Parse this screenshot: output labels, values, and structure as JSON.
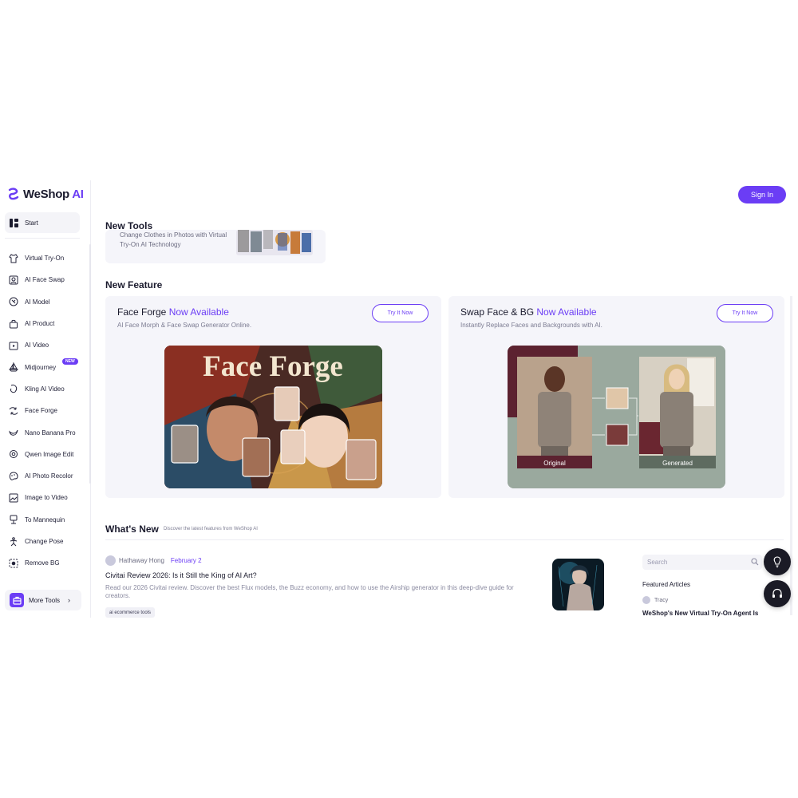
{
  "brand": {
    "name": "WeShop",
    "ai": "AI"
  },
  "header": {
    "sign_in": "Sign In"
  },
  "sidebar": {
    "start": "Start",
    "items": [
      {
        "label": "Virtual Try-On",
        "icon": "shirt-icon"
      },
      {
        "label": "AI Face Swap",
        "icon": "face-icon"
      },
      {
        "label": "AI Model",
        "icon": "model-icon"
      },
      {
        "label": "AI Product",
        "icon": "bag-icon"
      },
      {
        "label": "AI Video",
        "icon": "video-icon"
      },
      {
        "label": "Midjourney",
        "icon": "ship-icon",
        "badge": "NEW"
      },
      {
        "label": "Kling AI Video",
        "icon": "kling-icon"
      },
      {
        "label": "Face Forge",
        "icon": "swap-icon"
      },
      {
        "label": "Nano Banana Pro",
        "icon": "banana-icon"
      },
      {
        "label": "Qwen Image Edit",
        "icon": "qwen-icon"
      },
      {
        "label": "AI Photo Recolor",
        "icon": "palette-icon"
      },
      {
        "label": "Image to Video",
        "icon": "image-video-icon"
      },
      {
        "label": "To Mannequin",
        "icon": "mannequin-icon"
      },
      {
        "label": "Change Pose",
        "icon": "pose-icon"
      },
      {
        "label": "Remove BG",
        "icon": "remove-bg-icon"
      }
    ],
    "more_tools": "More Tools"
  },
  "new_tools": {
    "title": "New Tools",
    "description": "Change Clothes in Photos with Virtual Try-On AI Technology"
  },
  "new_feature": {
    "title": "New Feature",
    "cards": [
      {
        "title_main": "Face Forge",
        "title_highlight": "Now Available",
        "subtitle": "AI Face Morph & Face Swap Generator Online.",
        "button": "Try It Now",
        "image_text": "Face Forge"
      },
      {
        "title_main": "Swap Face & BG",
        "title_highlight": "Now Available",
        "subtitle": "Instantly Replace Faces and Backgrounds with AI.",
        "button": "Try It Now",
        "label_original": "Original",
        "label_generated": "Generated"
      }
    ]
  },
  "whats_new": {
    "title": "What's New",
    "subtitle": "Discover the latest features from WeShop AI",
    "article": {
      "author": "Hathaway Hong",
      "date": "February 2",
      "title": "Civitai Review 2026: Is it Still the King of AI Art?",
      "excerpt": "Read our 2026 Civitai review. Discover the best Flux models, the Buzz economy, and how to use the Airship generator in this deep-dive guide for creators.",
      "tag": "ai ecommerce tools"
    }
  },
  "right_panel": {
    "search_placeholder": "Search",
    "featured_title": "Featured Articles",
    "featured_author": "Tracy",
    "featured_article": "WeShop's New Virtual Try-On Agent Is"
  },
  "colors": {
    "accent": "#6b3df5",
    "card_bg": "#f5f5fa"
  }
}
